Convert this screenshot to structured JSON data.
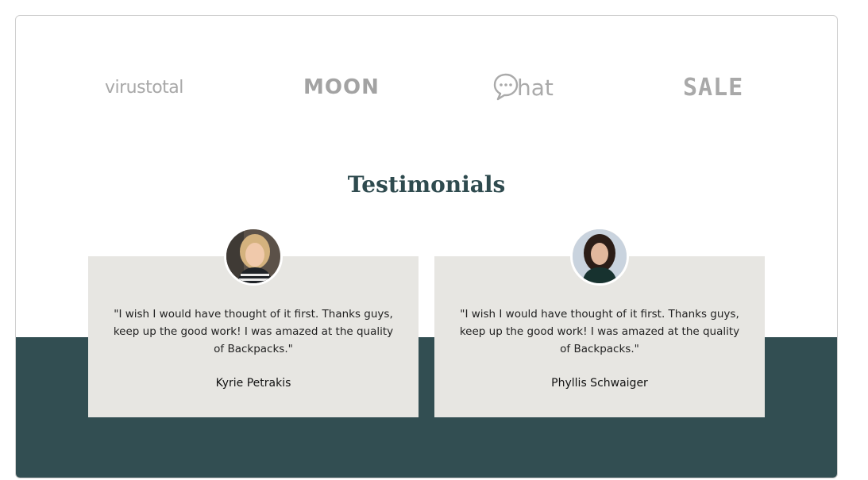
{
  "logos": [
    {
      "name": "virustotal"
    },
    {
      "name": "MOON"
    },
    {
      "name": "hat"
    },
    {
      "name": "SALE"
    }
  ],
  "testimonials": {
    "heading": "Testimonials",
    "cards": [
      {
        "quote": "\"I wish I would have thought of it first. Thanks guys, keep up the good work! I was amazed at the quality of Backpacks.\"",
        "author": "Kyrie Petrakis"
      },
      {
        "quote": "\"I wish I would have thought of it first. Thanks guys, keep up the good work! I was amazed at the quality of Backpacks.\"",
        "author": "Phyllis Schwaiger"
      }
    ]
  },
  "colors": {
    "band": "#324e52",
    "heading": "#2f4b4f",
    "card": "#e7e6e2",
    "logo_gray": "#a9a9a9"
  },
  "icons": [
    "chat-bubble-icon"
  ]
}
